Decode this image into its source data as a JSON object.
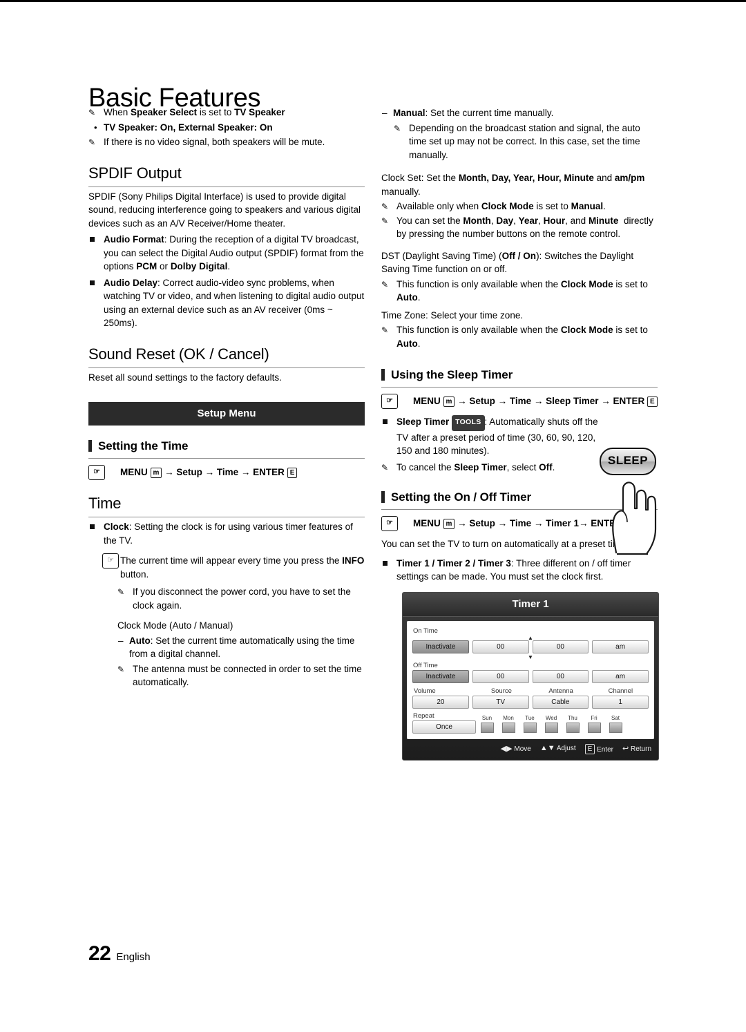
{
  "page": {
    "title": "Basic Features",
    "number": "22",
    "language": "English"
  },
  "left": {
    "note_speaker_select": "When Speaker Select is set to TV Speaker",
    "bullet_tv_speaker": "TV Speaker: On, External Speaker: On",
    "note_no_video": "If there is no video signal, both speakers will be mute.",
    "spdif_heading": "SPDIF Output",
    "spdif_intro": "SPDIF (Sony Philips Digital Interface) is used to provide digital sound, reducing interference going to speakers and various digital devices such as an A/V Receiver/Home theater.",
    "audio_format": "Audio Format: During the reception of a digital TV broadcast, you can select the Digital Audio output (SPDIF) format from the options PCM or Dolby Digital.",
    "audio_delay": "Audio Delay: Correct audio-video sync problems, when watching TV or video, and when listening to digital audio output using an external device such as an AV receiver (0ms ~ 250ms).",
    "sound_reset_heading": "Sound Reset (OK / Cancel)",
    "sound_reset_text": "Reset all sound settings to the factory defaults.",
    "setup_menu_bar": "Setup Menu",
    "setting_time_heading": "Setting the Time",
    "setting_time_path": "MENU m → Setup → Time → ENTER E",
    "time_heading": "Time",
    "clock_bullet": "Clock: Setting the clock is for using various timer features of the TV.",
    "info_note": "The current time will appear every time you press the INFO button.",
    "power_cord_note": "If you disconnect the power cord, you have to set the clock again.",
    "clock_mode_label": "Clock Mode (Auto / Manual)",
    "auto_dash": "Auto: Set the current time automatically using the time from a digital channel.",
    "antenna_note": "The antenna must be connected in order to set the time automatically."
  },
  "right": {
    "manual_dash": "Manual: Set the current time manually.",
    "broadcast_note": "Depending on the broadcast station and signal, the auto time set up may not be correct. In this case, set the time manually.",
    "clock_set": "Clock Set: Set the Month, Day, Year, Hour, Minute and am/pm manually.",
    "available_note": "Available only when Clock Mode is set to Manual.",
    "numbers_note": "You can set the Month, Day, Year, Hour, and Minute  directly by pressing the number buttons on the remote control.",
    "dst_text": "DST (Daylight Saving Time) (Off / On): Switches the Daylight Saving Time function on or off.",
    "dst_note": "This function is only available when the Clock Mode is set to Auto.",
    "time_zone_text": "Time Zone: Select your time zone.",
    "time_zone_note": "This function is only available when the Clock Mode is set to Auto.",
    "sleep_heading": "Using the Sleep Timer",
    "sleep_path": "MENU m → Setup → Time → Sleep Timer → ENTER E",
    "sleep_tools_label": "TOOLS",
    "sleep_bullet": "Sleep Timer : Automatically shuts off the TV after a preset period of time (30, 60, 90, 120, 150 and 180 minutes).",
    "sleep_cancel_note": "To cancel the Sleep Timer, select Off.",
    "sleep_button_label": "SLEEP",
    "onoff_heading": "Setting the On / Off Timer",
    "onoff_path": "MENU m → Setup → Time → Timer 1→ ENTER E",
    "onoff_intro": "You can set the TV to turn on automatically at a preset time.",
    "timer_bullet": "Timer 1 / Timer 2 / Timer 3: Three different on / off timer settings can be made. You must set the clock first."
  },
  "osd": {
    "title": "Timer 1",
    "on_time_label": "On Time",
    "off_time_label": "Off Time",
    "on_time_values": [
      "Inactivate",
      "00",
      "00",
      "am"
    ],
    "off_time_values": [
      "Inactivate",
      "00",
      "00",
      "am"
    ],
    "mid_headers": [
      "Volume",
      "Source",
      "Antenna",
      "Channel"
    ],
    "mid_values": [
      "20",
      "TV",
      "Cable",
      "1"
    ],
    "repeat_label": "Repeat",
    "repeat_value": "Once",
    "days": [
      "Sun",
      "Mon",
      "Tue",
      "Wed",
      "Thu",
      "Fri",
      "Sat"
    ],
    "footer": [
      {
        "icon": "◀▶",
        "label": "Move"
      },
      {
        "icon": "▲▼",
        "label": "Adjust"
      },
      {
        "icon": "E",
        "label": "Enter"
      },
      {
        "icon": "↩",
        "label": "Return"
      }
    ]
  }
}
